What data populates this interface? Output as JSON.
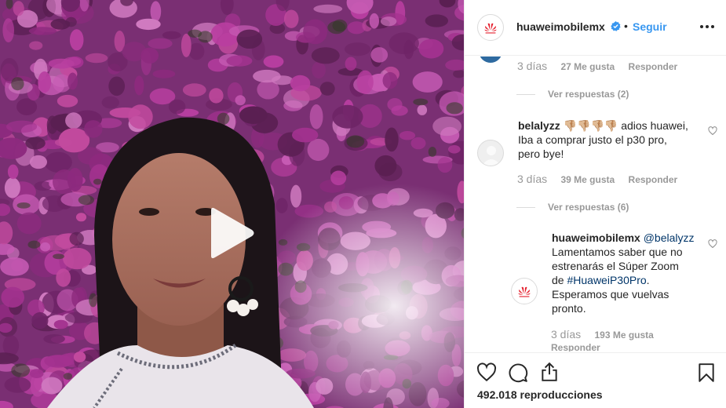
{
  "post": {
    "username": "huaweimobilemx",
    "dot": "•",
    "follow_label": "Seguir",
    "views_count": "492.018",
    "views_label": "reproducciones"
  },
  "comments": [
    {
      "time": "3 días",
      "likes": "27 Me gusta",
      "reply_label": "Responder",
      "view_replies": "Ver respuestas (2)"
    },
    {
      "username": "belalyzz",
      "emoji": "👎🏼👎🏼👎🏼👎🏼",
      "text_line1": " adios huawei,",
      "text_line2": "Iba a comprar justo el p30 pro,",
      "text_line3": "pero bye!",
      "time": "3 días",
      "likes": "39 Me gusta",
      "reply_label": "Responder",
      "view_replies": "Ver respuestas (6)"
    }
  ],
  "reply": {
    "username": "huaweimobilemx",
    "mention": "@belalyzz",
    "line1": "Lamentamos saber que no",
    "line2": "estrenarás el Súper Zoom",
    "line3_prefix": "de ",
    "hashtag": "#HuaweiP30Pro",
    "line3_suffix": ".",
    "line4": "Esperamos que vuelvas",
    "line5": "pronto.",
    "time": "3 días",
    "likes": "193 Me gusta",
    "reply_label": "Responder"
  },
  "colors": {
    "accent_blue": "#3897f0",
    "link_dark_blue": "#003569",
    "huawei_red": "#e41d2b",
    "flower_magenta": "#a3328f"
  },
  "icons": [
    "verified-badge-icon",
    "more-options-icon",
    "play-icon",
    "heart-icon",
    "comment-icon",
    "share-icon",
    "bookmark-icon",
    "huawei-logo-icon"
  ]
}
